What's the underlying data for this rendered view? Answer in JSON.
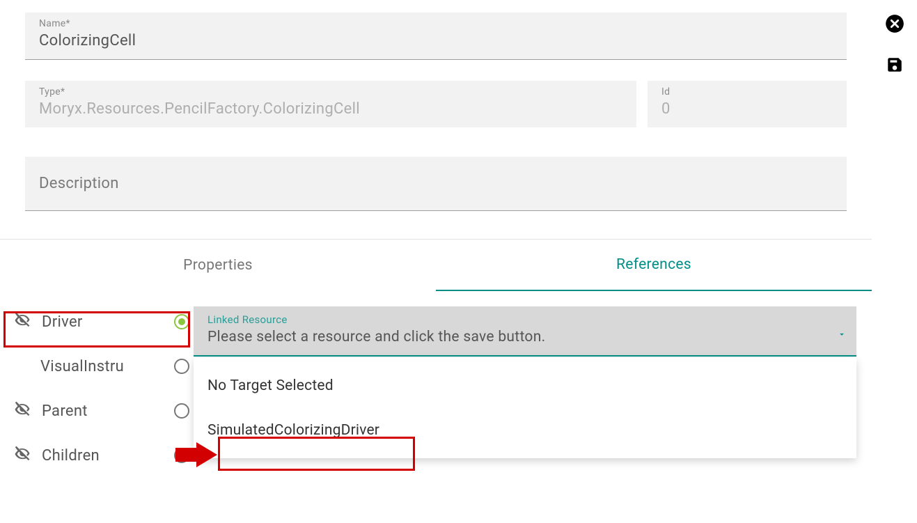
{
  "header": {
    "name_label": "Name*",
    "name_value": "ColorizingCell",
    "type_label": "Type*",
    "type_value": "Moryx.Resources.PencilFactory.ColorizingCell",
    "id_label": "Id",
    "id_value": "0",
    "description_label": "Description"
  },
  "tabs": {
    "properties": "Properties",
    "references": "References",
    "active": "references"
  },
  "references": {
    "items": [
      {
        "label": "Driver",
        "show_eye_off": true,
        "selected": true
      },
      {
        "label": "VisualInstru",
        "show_eye_off": false,
        "selected": false
      },
      {
        "label": "Parent",
        "show_eye_off": true,
        "selected": false
      },
      {
        "label": "Children",
        "show_eye_off": true,
        "selected": false
      }
    ]
  },
  "linked": {
    "label": "Linked Resource",
    "placeholder": "Please select a resource and click the save button.",
    "options": [
      "No Target Selected",
      "SimulatedColorizingDriver"
    ]
  },
  "icons": {
    "close": "close-icon",
    "save": "save-icon"
  }
}
